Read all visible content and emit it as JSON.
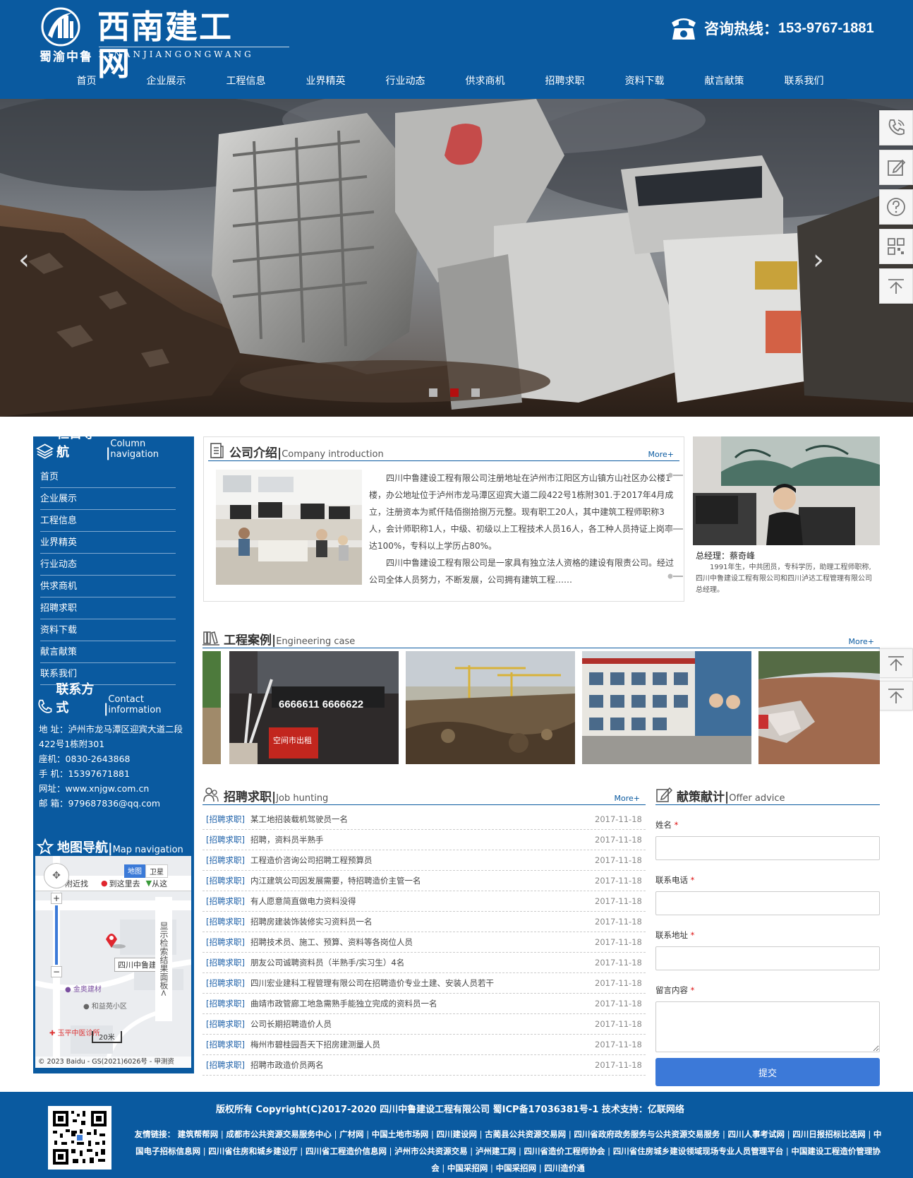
{
  "site": {
    "title": "西南建工网",
    "subtitle_cn": "蜀渝中鲁",
    "subtitle_en": "XINANJIANGONGWANG",
    "hotline_label": "咨询热线：",
    "hotline_number": "153-9767-1881",
    "brand_color": "#0a5aa0"
  },
  "nav": [
    "首页",
    "企业展示",
    "工程信息",
    "业界精英",
    "行业动态",
    "供求商机",
    "招聘求职",
    "资料下载",
    "献言献策",
    "联系我们"
  ],
  "banner": {
    "active_slide": 2,
    "slide_count": 3,
    "prev_icon": "‹",
    "next_icon": "›"
  },
  "sidebar": {
    "nav_title_cn": "栏目导航",
    "nav_title_en": "Column navigation",
    "items": [
      "首页",
      "企业展示",
      "工程信息",
      "业界精英",
      "行业动态",
      "供求商机",
      "招聘求职",
      "资料下载",
      "献言献策",
      "联系我们"
    ],
    "contact_title_cn": "联系方式",
    "contact_title_en": "Contact information",
    "contact_lines": [
      "地 址：泸州市龙马潭区迎宾大道二段",
      "422号1栋附301",
      "座机：0830-2643868",
      "手 机：15397671881",
      "网址：www.xnjgw.com.cn",
      "邮 箱：979687836@qq.com"
    ],
    "map_title_cn": "地图导航",
    "map_title_en": "Map navigation",
    "map": {
      "tab_map": "地图",
      "tab_sat": "卫星",
      "btn_nearby": "附近找",
      "btn_goto": "到这里去",
      "btn_from": "从这",
      "marker_label": "四川中鲁建",
      "poi1": "金奥建材",
      "poi2": "和益苑小区",
      "poi3": "玉平中医诊所",
      "scale": "20米",
      "panel_text": "显示检索结果面板<",
      "copyright": "© 2023 Baidu - GS(2021)6026号 - 甲测资"
    }
  },
  "intro": {
    "title_cn": "公司介绍",
    "title_en": "Company introduction",
    "more": "More+",
    "para1": "四川中鲁建设工程有限公司注册地址在泸州市江阳区方山镇方山社区办公楼1楼，办公地址位于泸州市龙马潭区迎宾大道二段422号1栋附301.于2017年4月成立，注册资本为贰仟陆佰捌拾捌万元整。现有职工20人，其中建筑工程师职称3人，会计师职称1人，中级、初级以上工程技术人员16人，各工种人员持证上岗率达100%，专科以上学历占80%。",
    "para2": "四川中鲁建设工程有限公司是一家具有独立法人资格的建设有限责公司。经过公司全体人员努力，不断发展，公司拥有建筑工程……"
  },
  "manager": {
    "name": "总经理：蔡奇峰",
    "desc": "1991年生，中共团员，专科学历，助理工程师职称,四川中鲁建设工程有限公司和四川泸达工程管理有限公司总经理。"
  },
  "cases": {
    "title_cn": "工程案例",
    "title_en": "Engineering case",
    "more": "More+"
  },
  "jobs": {
    "title_cn": "招聘求职",
    "title_en": "Job hunting",
    "more": "More+",
    "rows": [
      {
        "tag": "[招聘求职]",
        "title": "某工地招装载机驾驶员一名",
        "date": "2017-11-18"
      },
      {
        "tag": "[招聘求职]",
        "title": "招聘，资料员半熟手",
        "date": "2017-11-18"
      },
      {
        "tag": "[招聘求职]",
        "title": "工程造价咨询公司招聘工程预算员",
        "date": "2017-11-18"
      },
      {
        "tag": "[招聘求职]",
        "title": "内江建筑公司因发展需要，特招聘造价主管一名",
        "date": "2017-11-18"
      },
      {
        "tag": "[招聘求职]",
        "title": "有人愿意简直做电力资料没得",
        "date": "2017-11-18"
      },
      {
        "tag": "[招聘求职]",
        "title": "招聘房建装饰装修实习资料员一名",
        "date": "2017-11-18"
      },
      {
        "tag": "[招聘求职]",
        "title": "招聘技术员、施工、预算、资料等各岗位人员",
        "date": "2017-11-18"
      },
      {
        "tag": "[招聘求职]",
        "title": "朋友公司诚聘资料员（半熟手/实习生）4名",
        "date": "2017-11-18"
      },
      {
        "tag": "[招聘求职]",
        "title": "四川宏业建科工程管理有限公司在招聘造价专业土建、安装人员若干",
        "date": "2017-11-18"
      },
      {
        "tag": "[招聘求职]",
        "title": "曲靖市政管廊工地急需熟手能独立完成的资料员一名",
        "date": "2017-11-18"
      },
      {
        "tag": "[招聘求职]",
        "title": "公司长期招聘造价人员",
        "date": "2017-11-18"
      },
      {
        "tag": "[招聘求职]",
        "title": "梅州市碧桂园吾天下招房建测量人员",
        "date": "2017-11-18"
      },
      {
        "tag": "[招聘求职]",
        "title": "招聘市政造价员两名",
        "date": "2017-11-18"
      }
    ]
  },
  "advice": {
    "title_cn": "献策献计",
    "title_en": "Offer advice",
    "name_label": "姓名",
    "phone_label": "联系电话",
    "address_label": "联系地址",
    "message_label": "留言内容",
    "required_mark": "*",
    "submit": "提交"
  },
  "footer": {
    "copyright": "版权所有 Copyright(C)2017-2020  四川中鲁建设工程有限公司  蜀ICP备17036381号-1  技术支持：亿联网络",
    "links_label": "友情链接：",
    "links": [
      "建筑帮帮网",
      "成都市公共资源交易服务中心",
      "广材网",
      "中国土地市场网",
      "四川建设网",
      "古蔺县公共资源交易网",
      "四川省政府政务服务与公共资源交易服务",
      "四川人事考试网",
      "四川日报招标比选网",
      "中国电子招标信息网",
      "四川省住房和城乡建设厅",
      "四川省工程造价信息网",
      "泸州市公共资源交易",
      "泸州建工网",
      "四川省造价工程师协会",
      "四川省住房城乡建设领域现场专业人员管理平台",
      "中国建设工程造价管理协会",
      "中国采招网",
      "中国采招网",
      "四川造价通"
    ]
  }
}
